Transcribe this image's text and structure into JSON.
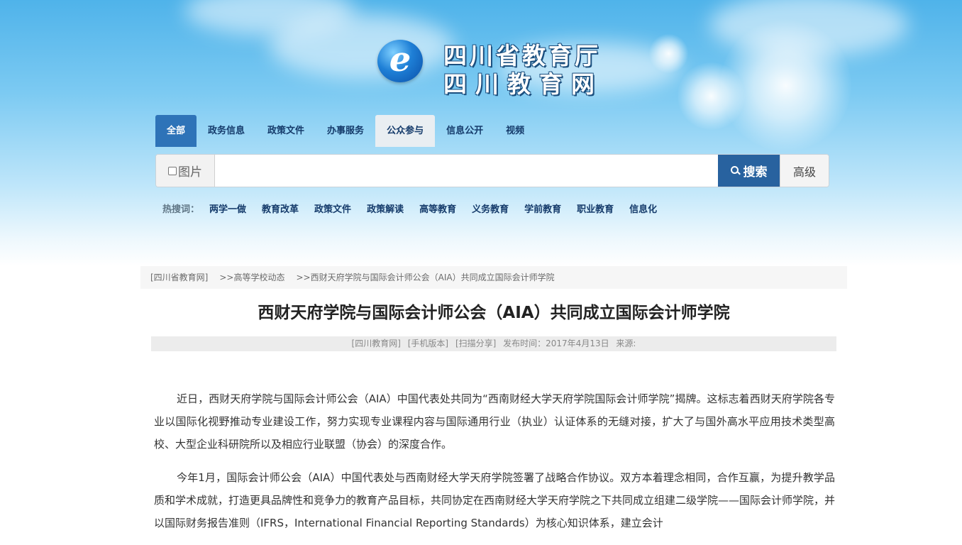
{
  "site": {
    "logo_mark": "e",
    "logo_line1": "四川省教育厅",
    "logo_line2": "四川教育网"
  },
  "nav": {
    "tabs": [
      "全部",
      "政务信息",
      "政策文件",
      "办事服务",
      "公众参与",
      "信息公开",
      "视频"
    ],
    "active_index": 0,
    "hover_index": 4
  },
  "search": {
    "image_option_label": "图片",
    "query_value": "",
    "search_button_label": "搜索",
    "advanced_button_label": "高级"
  },
  "hot_words": {
    "label": "热搜词：",
    "items": [
      "两学一做",
      "教育改革",
      "政策文件",
      "政策解读",
      "高等教育",
      "义务教育",
      "学前教育",
      "职业教育",
      "信息化"
    ]
  },
  "breadcrumb": {
    "items": [
      "[四川省教育网]",
      ">>高等学校动态",
      ">>西财天府学院与国际会计师公会（AIA）共同成立国际会计师学院"
    ]
  },
  "article": {
    "title": "西财天府学院与国际会计师公会（AIA）共同成立国际会计师学院",
    "meta": {
      "source_tag": "[四川教育网]",
      "mobile_link": "[手机版本]",
      "share_link": "[扫描分享]",
      "publish_label": "发布时间：2017年4月13日",
      "source_label": "来源:"
    },
    "paragraphs": [
      "近日，西财天府学院与国际会计师公会（AIA）中国代表处共同为“西南财经大学天府学院国际会计师学院”揭牌。这标志着西财天府学院各专业以国际化视野推动专业建设工作，努力实现专业课程内容与国际通用行业（执业）认证体系的无缝对接，扩大了与国外高水平应用技术类型高校、大型企业科研院所以及相应行业联盟（协会）的深度合作。",
      "今年1月，国际会计师公会（AIA）中国代表处与西南财经大学天府学院签署了战略合作协议。双方本着理念相同，合作互赢，为提升教学品质和学术成就，打造更具品牌性和竞争力的教育产品目标，共同协定在西南财经大学天府学院之下共同成立组建二级学院——国际会计师学院，并以国际财务报告准则（IFRS，International Financial Reporting Standards）为核心知识体系，建立会计"
    ]
  }
}
